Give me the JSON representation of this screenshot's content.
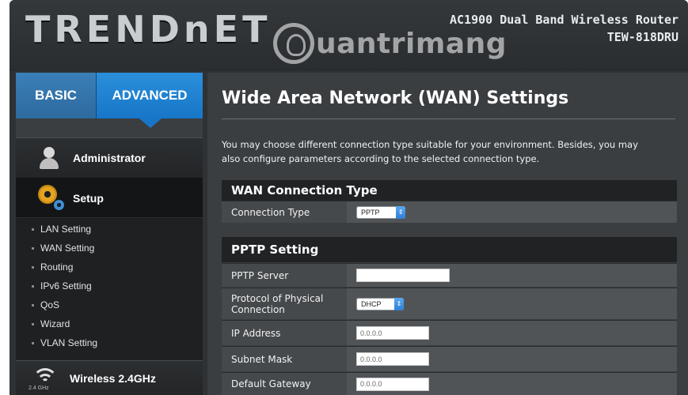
{
  "header": {
    "logo": "TRENDnET",
    "model_line1": "AC1900 Dual Band Wireless Router",
    "model_line2": "TEW-818DRU",
    "watermark": "uantrimang"
  },
  "sidebar": {
    "tabs": [
      {
        "label": "BASIC"
      },
      {
        "label": "ADVANCED"
      }
    ],
    "menu": {
      "administrator": "Administrator",
      "setup": "Setup",
      "wireless": "Wireless 2.4GHz",
      "wireless_band": "2.4 GHz"
    },
    "setup_items": [
      {
        "label": "LAN Setting"
      },
      {
        "label": "WAN Setting"
      },
      {
        "label": "Routing"
      },
      {
        "label": "IPv6 Setting"
      },
      {
        "label": "QoS"
      },
      {
        "label": "Wizard"
      },
      {
        "label": "VLAN Setting"
      }
    ]
  },
  "main": {
    "title": "Wide Area Network (WAN) Settings",
    "intro_line1": "You may choose different connection type suitable for your environment. Besides, you may",
    "intro_line2": "also configure parameters according to the selected connection type.",
    "wan_section": {
      "heading": "WAN Connection Type",
      "connection_type_label": "Connection Type",
      "connection_type_value": "PPTP"
    },
    "pptp_section": {
      "heading": "PPTP Setting",
      "server_label": "PPTP Server",
      "server_value": "",
      "protocol_label": "Protocol of Physical Connection",
      "protocol_value": "DHCP",
      "ip_label": "IP Address",
      "ip_value": "0.0.0.0",
      "subnet_label": "Subnet Mask",
      "subnet_value": "0.0.0.0",
      "gateway_label": "Default Gateway",
      "gateway_value": "0.0.0.0"
    }
  },
  "colors": {
    "accent_blue": "#1876c8",
    "panel_gray": "#3a3e41",
    "sidebar_dark": "#1e2022"
  }
}
